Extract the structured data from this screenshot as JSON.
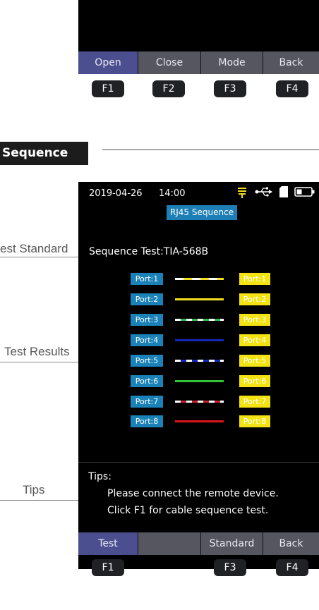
{
  "top_screen": {
    "softkeys": [
      "Open",
      "Close",
      "Mode",
      "Back"
    ],
    "fkeys": [
      "F1",
      "F2",
      "F3",
      "F4"
    ]
  },
  "section": {
    "title": "Sequence"
  },
  "callouts": {
    "test_standard": "est Standard",
    "test_results": "Test Results",
    "tips": "Tips"
  },
  "screen": {
    "status": {
      "date": "2019-04-26",
      "time": "14:00"
    },
    "title": "RJ45 Sequence",
    "standard_label": "Sequence Test:",
    "standard_value": "TIA-568B",
    "pairs": [
      {
        "left": "Port:1",
        "right": "Port:1",
        "wire": "white-orange"
      },
      {
        "left": "Port:2",
        "right": "Port:2",
        "wire": "orange"
      },
      {
        "left": "Port:3",
        "right": "Port:3",
        "wire": "white-green"
      },
      {
        "left": "Port:4",
        "right": "Port:4",
        "wire": "blue"
      },
      {
        "left": "Port:5",
        "right": "Port:5",
        "wire": "white-blue"
      },
      {
        "left": "Port:6",
        "right": "Port:6",
        "wire": "green"
      },
      {
        "left": "Port:7",
        "right": "Port:7",
        "wire": "white-brown"
      },
      {
        "left": "Port:8",
        "right": "Port:8",
        "wire": "red"
      }
    ],
    "tips": {
      "title": "Tips:",
      "lines": [
        "Please connect the remote device.",
        "Click F1 for cable sequence test."
      ]
    },
    "softkeys": [
      "Test",
      "",
      "Standard",
      "Back"
    ],
    "fkeys": [
      "F1",
      "F3",
      "F4"
    ]
  },
  "colors": {
    "softkey_active": "#4b4f8f",
    "softkey_inactive": "#565661",
    "port_left": "#1a82b8",
    "port_right": "#f4e313",
    "title_badge": "#1e7fb6"
  }
}
